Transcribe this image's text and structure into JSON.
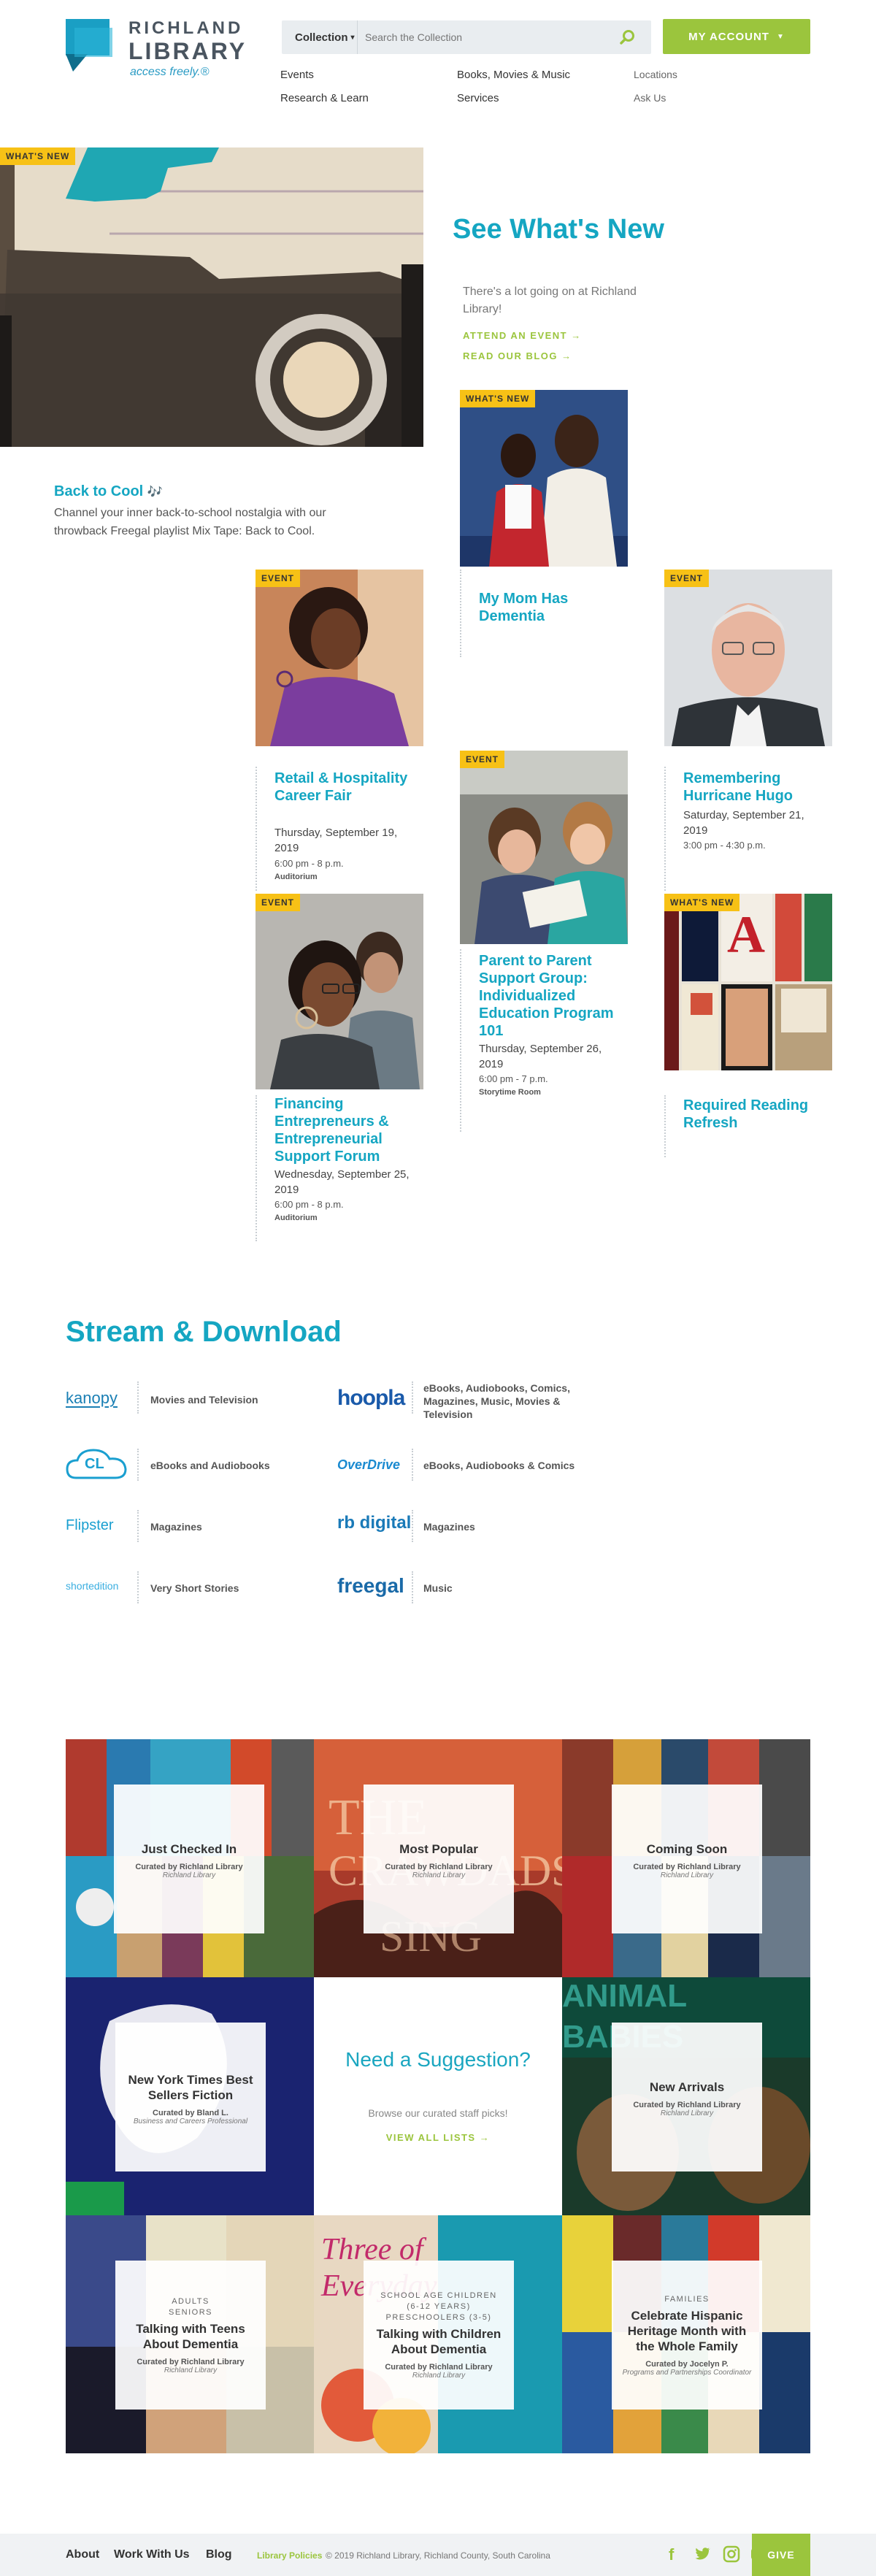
{
  "header": {
    "logo_name_line1": "RICHLAND",
    "logo_name_line2": "LIBRARY",
    "logo_tagline": "access freely.®",
    "collection_select": "Collection",
    "search_placeholder": "Search the Collection",
    "account_button": "MY ACCOUNT",
    "nav": {
      "events": "Events",
      "research": "Research & Learn",
      "books": "Books, Movies & Music",
      "services": "Services",
      "locations": "Locations",
      "ask_us": "Ask Us"
    }
  },
  "hero": {
    "badge": "WHAT'S NEW",
    "title": "See What's New",
    "description": "There's a lot going on at Richland Library!",
    "cta_event": "ATTEND AN EVENT →",
    "cta_blog": "READ OUR BLOG →",
    "feature_title": "Back to Cool",
    "feature_title_icon": "🎶",
    "feature_desc": "Channel your inner back-to-school nostalgia with our throwback Freegal playlist Mix Tape: Back to Cool."
  },
  "cards": [
    {
      "badge": "WHAT'S NEW",
      "title": "My Mom Has Dementia"
    },
    {
      "badge": "EVENT",
      "title": "Retail & Hospitality Career Fair",
      "date": "Thursday, September 19, 2019",
      "time": "6:00 pm - 8 p.m.",
      "location": "Auditorium"
    },
    {
      "badge": "EVENT",
      "title": "Remembering Hurricane Hugo",
      "date": "Saturday, September 21, 2019",
      "time": "3:00 pm - 4:30 p.m."
    },
    {
      "badge": "EVENT",
      "title": "Parent to Parent Support Group: Individualized Education Program 101",
      "date": "Thursday, September 26, 2019",
      "time": "6:00 pm - 7 p.m.",
      "location": "Storytime Room"
    },
    {
      "badge": "EVENT",
      "title": "Financing Entrepreneurs & Entrepreneurial Support Forum",
      "date": "Wednesday, September 25, 2019",
      "time": "6:00 pm - 8 p.m.",
      "location": "Auditorium"
    },
    {
      "badge": "WHAT'S NEW",
      "title": "Required Reading Refresh"
    }
  ],
  "stream": {
    "title": "Stream & Download",
    "services": [
      {
        "logo": "kanopy",
        "label": "Movies and Television"
      },
      {
        "logo": "hoopla",
        "label": "eBooks, Audiobooks, Comics, Magazines, Music, Movies & Television"
      },
      {
        "logo": "CL",
        "label": "eBooks and Audiobooks"
      },
      {
        "logo": "OverDrive",
        "label": "eBooks, Audiobooks & Comics"
      },
      {
        "logo": "Flipster",
        "label": "Magazines"
      },
      {
        "logo": "rb digital",
        "label": "Magazines"
      },
      {
        "logo": "shortedition",
        "label": "Very Short Stories"
      },
      {
        "logo": "freegal",
        "label": "Music"
      }
    ]
  },
  "lists": {
    "just_checked_in": {
      "title": "Just Checked In",
      "by": "Curated by Richland Library",
      "org": "Richland Library"
    },
    "most_popular": {
      "title": "Most Popular",
      "by": "Curated by Richland Library",
      "org": "Richland Library"
    },
    "coming_soon": {
      "title": "Coming Soon",
      "by": "Curated by Richland Library",
      "org": "Richland Library"
    },
    "nyt": {
      "title": "New York Times Best Sellers Fiction",
      "by": "Curated by Bland L.",
      "org": "Business and Careers Professional"
    },
    "suggestion": {
      "title": "Need a Suggestion?",
      "sub": "Browse our curated staff picks!",
      "cta": "VIEW ALL LISTS →"
    },
    "new_arrivals": {
      "title": "New Arrivals",
      "by": "Curated by Richland Library",
      "org": "Richland Library"
    },
    "teens": {
      "kicker1": "ADULTS",
      "kicker2": "SENIORS",
      "title": "Talking with Teens About Dementia",
      "by": "Curated by Richland Library",
      "org": "Richland Library"
    },
    "children": {
      "kicker1": "SCHOOL AGE CHILDREN (6-12 YEARS)",
      "kicker2": "PRESCHOOLERS (3-5)",
      "title": "Talking with Children About Dementia",
      "by": "Curated by Richland Library",
      "org": "Richland Library"
    },
    "hispanic": {
      "kicker1": "FAMILIES",
      "title": "Celebrate Hispanic Heritage Month with the Whole Family",
      "by": "Curated by Jocelyn P.",
      "org": "Programs and Partnerships Coordinator"
    }
  },
  "footer": {
    "about": "About",
    "work": "Work With Us",
    "blog": "Blog",
    "policies": "Library Policies",
    "copyright": "© 2019 Richland Library, Richland County, South Carolina",
    "give": "GIVE"
  },
  "colors": {
    "accent": "#15a6c2",
    "green": "#9bc53d",
    "badge": "#f7c116"
  }
}
